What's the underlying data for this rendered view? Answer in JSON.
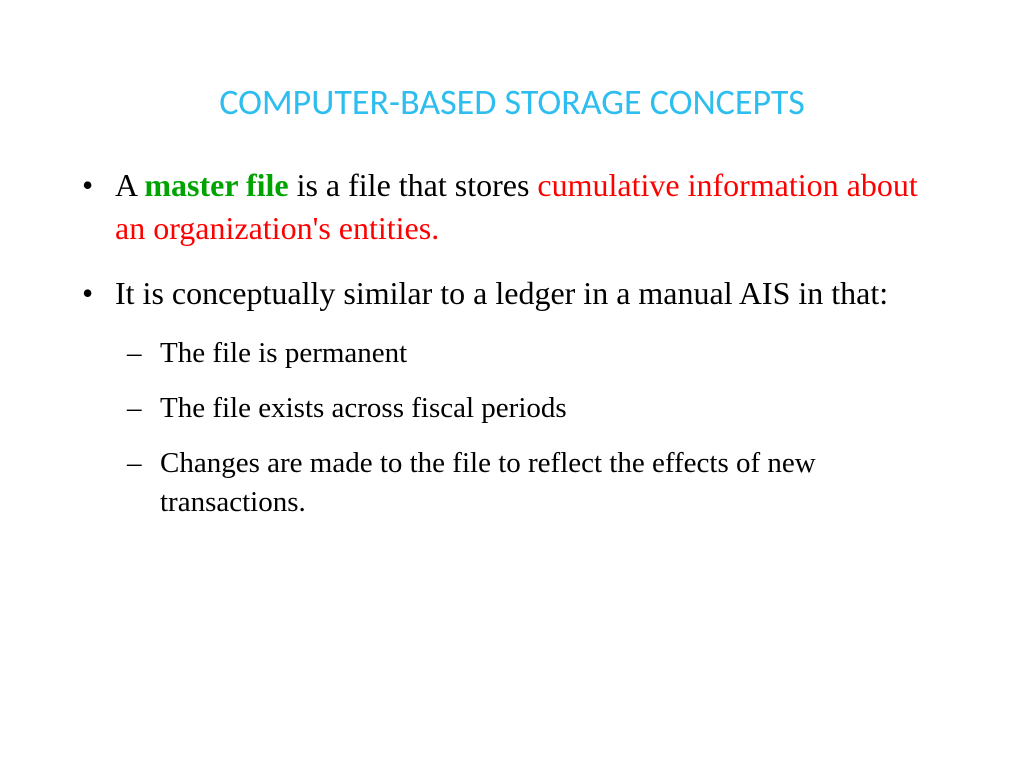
{
  "title": "COMPUTER-BASED STORAGE CONCEPTS",
  "bullets": [
    {
      "pre": "A ",
      "green": "master file",
      "mid": " is a file that stores ",
      "red": "cumulative information about an organization's entities."
    },
    {
      "text": "It is conceptually similar to a ledger in a manual AIS in that:",
      "subs": [
        "The file is permanent",
        "The file exists across fiscal periods",
        "Changes are made to the file to reflect the effects of new transactions."
      ]
    }
  ]
}
